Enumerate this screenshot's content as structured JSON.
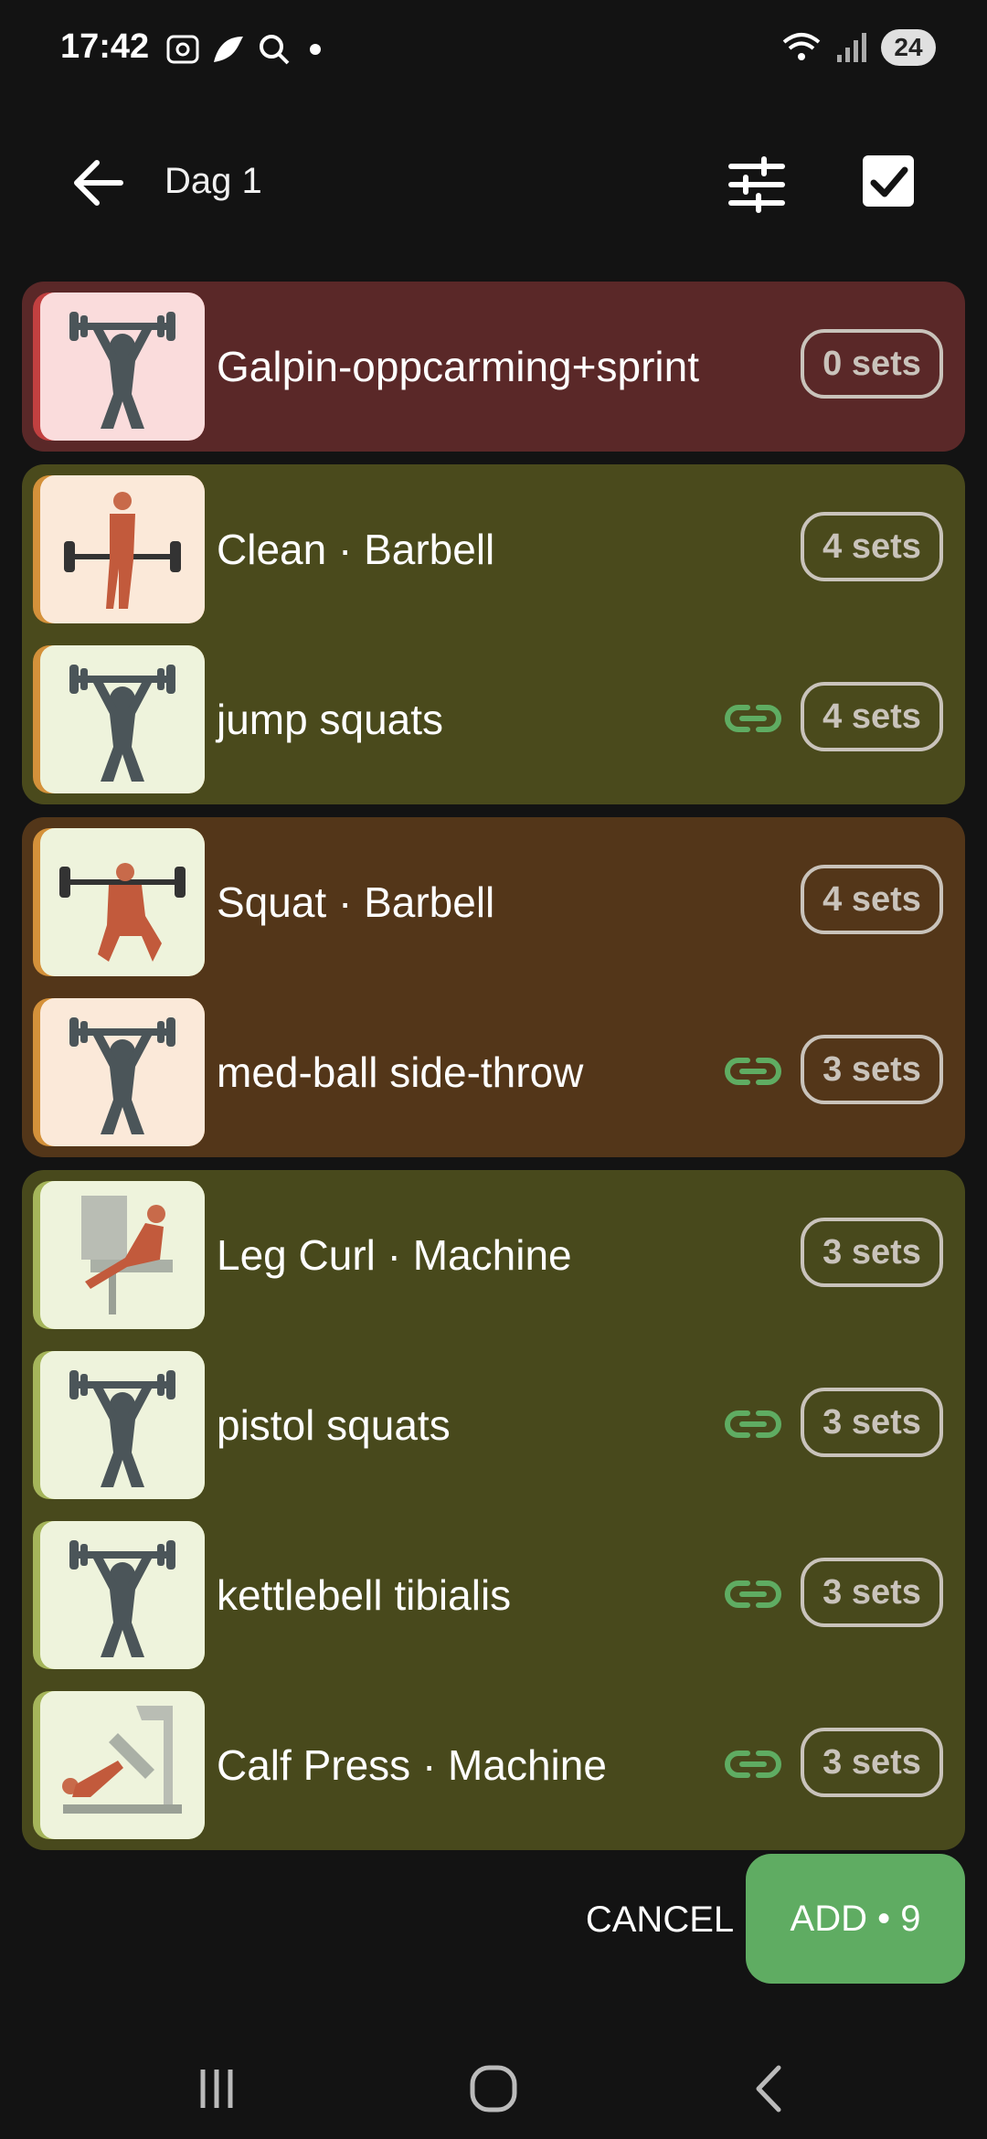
{
  "status_bar": {
    "time": "17:42",
    "battery": "24"
  },
  "header": {
    "title": "Dag 1"
  },
  "groups": [
    {
      "color": "#5a2828",
      "accent": "#c24040",
      "items": [
        {
          "name": "Galpin-oppcarming+sprint",
          "sets": "0 sets",
          "linked": false,
          "thumb": "placeholder",
          "thumb_bg": "#fadcdc"
        }
      ]
    },
    {
      "color": "#4a4a1c",
      "accent": "#d4913a",
      "items": [
        {
          "name": "Clean · Barbell",
          "sets": "4 sets",
          "linked": false,
          "thumb": "barbell-clean",
          "thumb_bg": "#fbe9d9"
        },
        {
          "name": "jump squats",
          "sets": "4 sets",
          "linked": true,
          "thumb": "placeholder",
          "thumb_bg": "#eef3dc"
        }
      ]
    },
    {
      "color": "#533619",
      "accent": "#d4913a",
      "items": [
        {
          "name": "Squat · Barbell",
          "sets": "4 sets",
          "linked": false,
          "thumb": "barbell-squat",
          "thumb_bg": "#eef3dc"
        },
        {
          "name": "med-ball side-throw",
          "sets": "3 sets",
          "linked": true,
          "thumb": "placeholder",
          "thumb_bg": "#fbe9d9"
        }
      ]
    },
    {
      "color": "#48491c",
      "accent": "#a5b55a",
      "items": [
        {
          "name": "Leg Curl · Machine",
          "sets": "3 sets",
          "linked": false,
          "thumb": "leg-curl-machine",
          "thumb_bg": "#eef3dc"
        },
        {
          "name": "pistol squats",
          "sets": "3 sets",
          "linked": true,
          "thumb": "placeholder",
          "thumb_bg": "#eef3dc"
        },
        {
          "name": "kettlebell tibialis",
          "sets": "3 sets",
          "linked": true,
          "thumb": "placeholder",
          "thumb_bg": "#eef3dc"
        },
        {
          "name": "Calf Press · Machine",
          "sets": "3 sets",
          "linked": true,
          "thumb": "calf-press-machine",
          "thumb_bg": "#eef3dc"
        }
      ]
    }
  ],
  "actions": {
    "cancel": "CANCEL",
    "add": "ADD • 9"
  },
  "link_color": "#5fac62"
}
